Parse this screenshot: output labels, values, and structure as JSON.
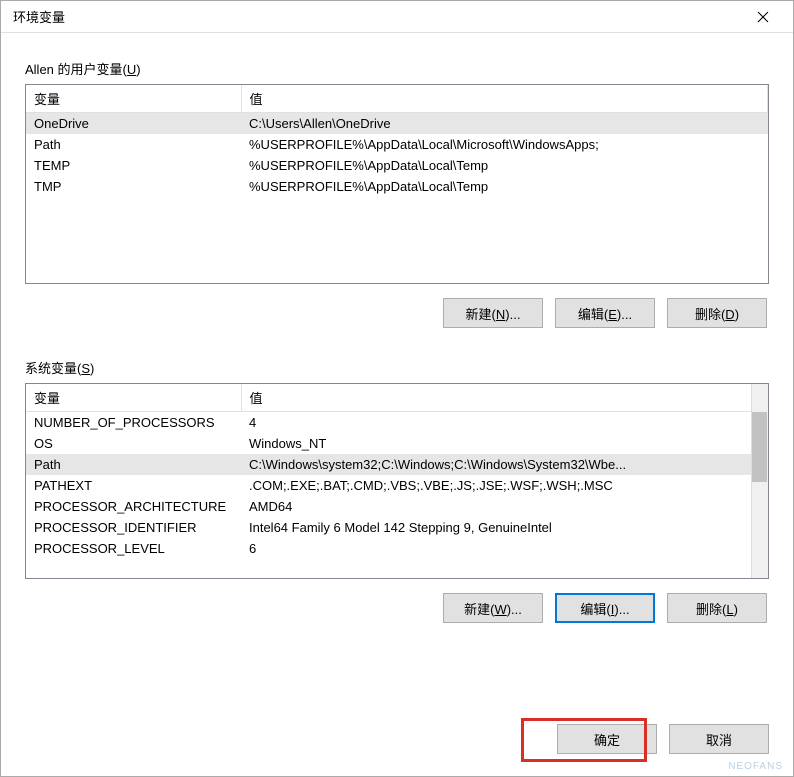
{
  "window": {
    "title": "环境变量"
  },
  "user_section": {
    "label_prefix": "Allen 的用户变量(",
    "label_hotkey": "U",
    "label_suffix": ")",
    "columns": {
      "variable": "变量",
      "value": "值"
    },
    "rows": [
      {
        "name": "OneDrive",
        "value": "C:\\Users\\Allen\\OneDrive",
        "selected": true
      },
      {
        "name": "Path",
        "value": "%USERPROFILE%\\AppData\\Local\\Microsoft\\WindowsApps;",
        "selected": false
      },
      {
        "name": "TEMP",
        "value": "%USERPROFILE%\\AppData\\Local\\Temp",
        "selected": false
      },
      {
        "name": "TMP",
        "value": "%USERPROFILE%\\AppData\\Local\\Temp",
        "selected": false
      }
    ],
    "buttons": {
      "new": {
        "prefix": "新建(",
        "hotkey": "N",
        "suffix": ")..."
      },
      "edit": {
        "prefix": "编辑(",
        "hotkey": "E",
        "suffix": ")..."
      },
      "delete": {
        "prefix": "删除(",
        "hotkey": "D",
        "suffix": ")"
      }
    }
  },
  "system_section": {
    "label_prefix": "系统变量(",
    "label_hotkey": "S",
    "label_suffix": ")",
    "columns": {
      "variable": "变量",
      "value": "值"
    },
    "rows": [
      {
        "name": "NUMBER_OF_PROCESSORS",
        "value": "4",
        "selected": false
      },
      {
        "name": "OS",
        "value": "Windows_NT",
        "selected": false
      },
      {
        "name": "Path",
        "value": "C:\\Windows\\system32;C:\\Windows;C:\\Windows\\System32\\Wbe...",
        "selected": true
      },
      {
        "name": "PATHEXT",
        "value": ".COM;.EXE;.BAT;.CMD;.VBS;.VBE;.JS;.JSE;.WSF;.WSH;.MSC",
        "selected": false
      },
      {
        "name": "PROCESSOR_ARCHITECTURE",
        "value": "AMD64",
        "selected": false
      },
      {
        "name": "PROCESSOR_IDENTIFIER",
        "value": "Intel64 Family 6 Model 142 Stepping 9, GenuineIntel",
        "selected": false
      },
      {
        "name": "PROCESSOR_LEVEL",
        "value": "6",
        "selected": false
      }
    ],
    "buttons": {
      "new": {
        "prefix": "新建(",
        "hotkey": "W",
        "suffix": ")..."
      },
      "edit": {
        "prefix": "编辑(",
        "hotkey": "I",
        "suffix": ")..."
      },
      "delete": {
        "prefix": "删除(",
        "hotkey": "L",
        "suffix": ")"
      }
    }
  },
  "footer": {
    "ok": "确定",
    "cancel": "取消"
  },
  "watermark": "NEOFANS"
}
